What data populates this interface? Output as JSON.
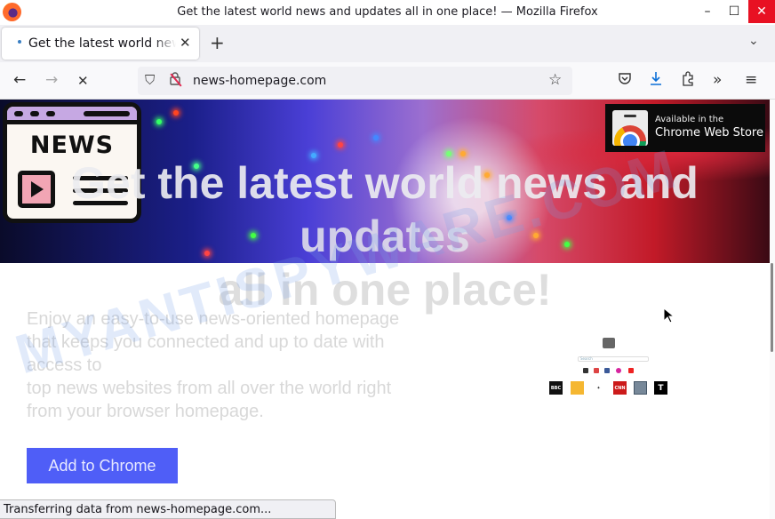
{
  "window": {
    "title": "Get the latest world news and updates all in one place! — Mozilla Firefox",
    "controls": {
      "minimize": "–",
      "maximize": "☐",
      "close": "✕"
    }
  },
  "tabs": [
    {
      "label": "Get the latest world news and updates all in one place!",
      "loading": true,
      "close": "✕"
    }
  ],
  "tabbar": {
    "new_tab": "+",
    "list_all_tabs": "⌄"
  },
  "navbar": {
    "back": "←",
    "forward": "→",
    "stop": "✕",
    "url": "news-homepage.com",
    "icons": {
      "shield": "⛉",
      "lock": "🔒",
      "bookmark": "☆",
      "pocket": "◡",
      "downloads": "⤓",
      "extensions": "⧉",
      "overflow": "»",
      "menu": "≡"
    }
  },
  "page": {
    "logo_text": "NEWS",
    "chrome_store_badge": {
      "line1": "Available in the",
      "line2": "Chrome Web Store"
    },
    "headline": [
      "Get the latest world news and",
      "updates",
      "all in one place!"
    ],
    "description_lines": [
      "Enjoy an easy-to-use news-oriented homepage",
      "that keeps you connected and up to date with",
      "access to",
      "top news websites from all over the world right",
      "from your browser homepage."
    ],
    "cta_label": "Add to Chrome",
    "preview": {
      "search_placeholder": "Search",
      "sites": [
        "BBC",
        "HuffPost",
        "NBC",
        "CNN",
        "",
        "T"
      ]
    },
    "watermark": "MYANTISPYWARE.COM"
  },
  "status": "Transferring data from news-homepage.com...",
  "colors": {
    "cta_bg": "#4f5ef7",
    "close_hover": "#e81123",
    "tab_loading_dot": "#3a7fc3"
  }
}
